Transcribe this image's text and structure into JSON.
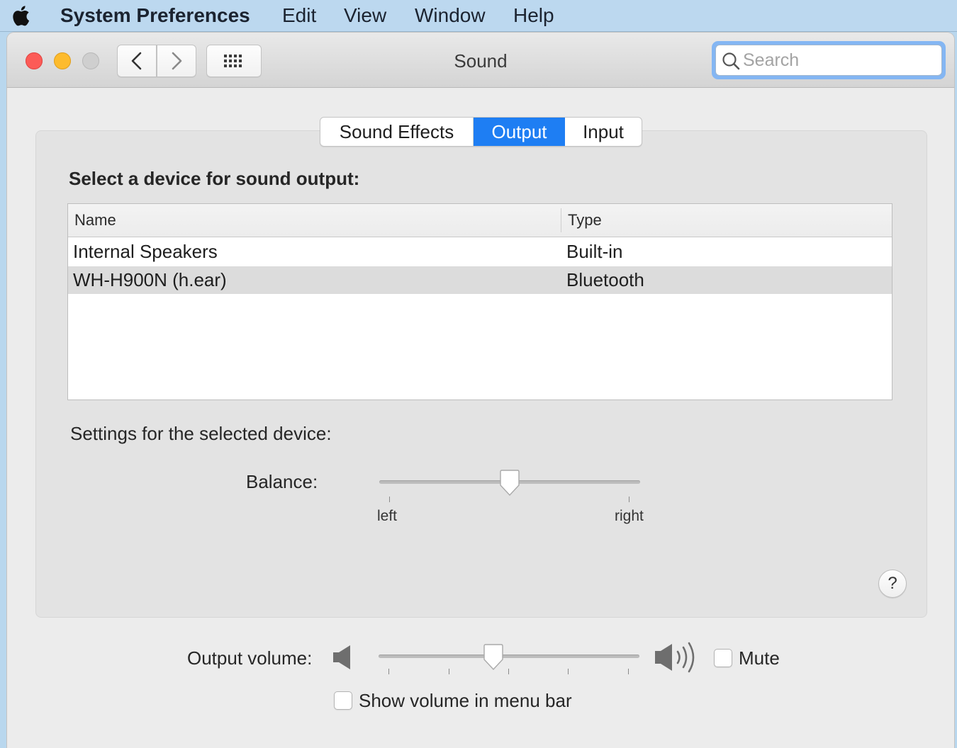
{
  "menubar": {
    "app_name": "System Preferences",
    "items": [
      "Edit",
      "View",
      "Window",
      "Help"
    ]
  },
  "window": {
    "title": "Sound",
    "search": {
      "placeholder": "Search",
      "value": ""
    }
  },
  "tabs": [
    {
      "label": "Sound Effects",
      "selected": false
    },
    {
      "label": "Output",
      "selected": true
    },
    {
      "label": "Input",
      "selected": false
    }
  ],
  "output": {
    "heading": "Select a device for sound output:",
    "columns": {
      "name": "Name",
      "type": "Type"
    },
    "devices": [
      {
        "name": "Internal Speakers",
        "type": "Built-in",
        "selected": false
      },
      {
        "name": "WH-H900N (h.ear)",
        "type": "Bluetooth",
        "selected": true
      }
    ],
    "settings_label": "Settings for the selected device:",
    "balance": {
      "label": "Balance:",
      "left_label": "left",
      "right_label": "right",
      "value": 0.5
    }
  },
  "volume": {
    "label": "Output volume:",
    "value": 0.44,
    "mute_label": "Mute",
    "mute_checked": false,
    "show_in_menu_bar_label": "Show volume in menu bar",
    "show_in_menu_bar_checked": false
  },
  "help": {
    "label": "?"
  },
  "colors": {
    "accent": "#1e7ef3",
    "menubar": "#bcd8ef",
    "close": "#fc5b57",
    "minimize": "#fdbb2d",
    "zoom": "#cfcfcf"
  }
}
